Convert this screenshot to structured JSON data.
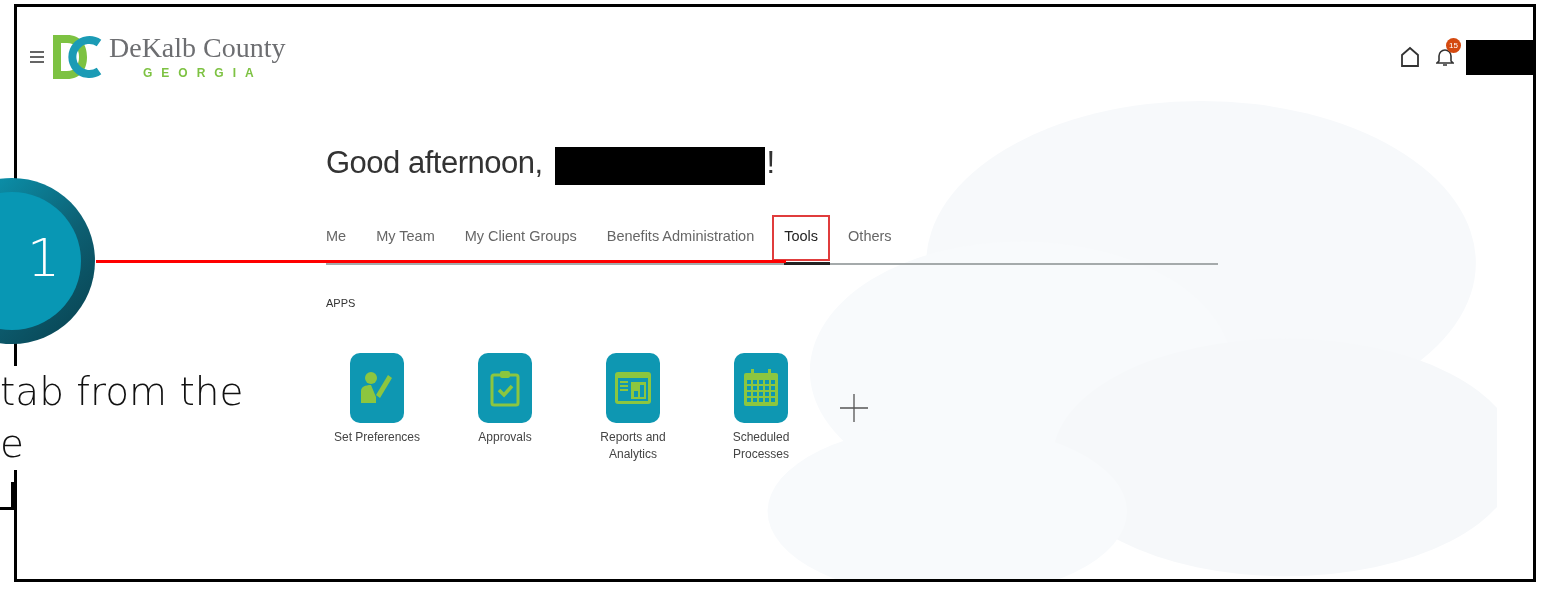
{
  "header": {
    "brand": "DeKalb County",
    "brand_sub": "GEORGIA",
    "notification_count": "15"
  },
  "greeting": {
    "prefix": "Good afternoon,",
    "suffix": "!"
  },
  "tabs": [
    {
      "label": "Me",
      "selected": false,
      "highlighted": false
    },
    {
      "label": "My Team",
      "selected": false,
      "highlighted": false
    },
    {
      "label": "My Client Groups",
      "selected": false,
      "highlighted": false
    },
    {
      "label": "Benefits Administration",
      "selected": false,
      "highlighted": false
    },
    {
      "label": "Tools",
      "selected": true,
      "highlighted": true
    },
    {
      "label": "Others",
      "selected": false,
      "highlighted": false
    }
  ],
  "apps": {
    "heading": "APPS",
    "items": [
      {
        "label": "Set Preferences",
        "kind": "preferences"
      },
      {
        "label": "Approvals",
        "kind": "approvals"
      },
      {
        "label": "Reports and Analytics",
        "kind": "reports"
      },
      {
        "label": "Scheduled Processes",
        "kind": "schedule"
      }
    ]
  },
  "callout": {
    "step": "1",
    "lines": [
      "tab from the",
      "e"
    ]
  }
}
